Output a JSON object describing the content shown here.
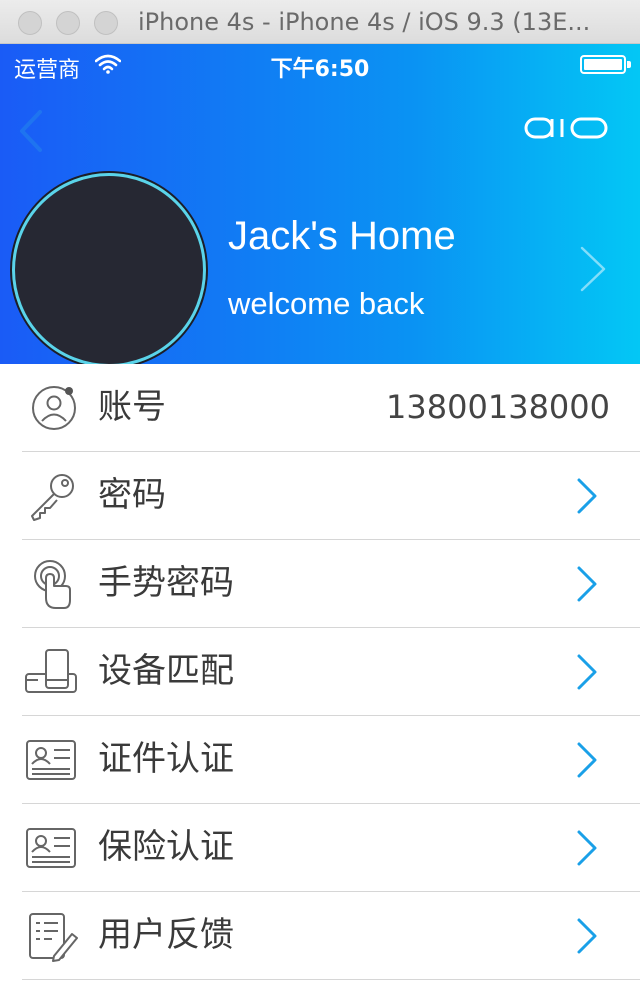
{
  "window": {
    "title": "iPhone 4s - iPhone 4s / iOS 9.3 (13E..."
  },
  "status_bar": {
    "carrier": "运营商",
    "time": "下午6:50",
    "battery_level": 1.0
  },
  "header": {
    "logo_text": "aio",
    "home_name": "Jack's Home",
    "subtitle": "welcome back"
  },
  "colors": {
    "gradient_start": "#1a5bf6",
    "gradient_end": "#03c7f5",
    "accent": "#1aa0e8",
    "avatar_ring": "#5ad4ea"
  },
  "menu": [
    {
      "label": "账号",
      "value": "13800138000",
      "icon": "account-icon"
    },
    {
      "label": "密码",
      "icon": "key-icon"
    },
    {
      "label": "手势密码",
      "icon": "gesture-icon"
    },
    {
      "label": "设备匹配",
      "icon": "device-icon"
    },
    {
      "label": "证件认证",
      "icon": "id-card-icon"
    },
    {
      "label": "保险认证",
      "icon": "insurance-card-icon"
    },
    {
      "label": "用户反馈",
      "icon": "feedback-icon"
    }
  ]
}
